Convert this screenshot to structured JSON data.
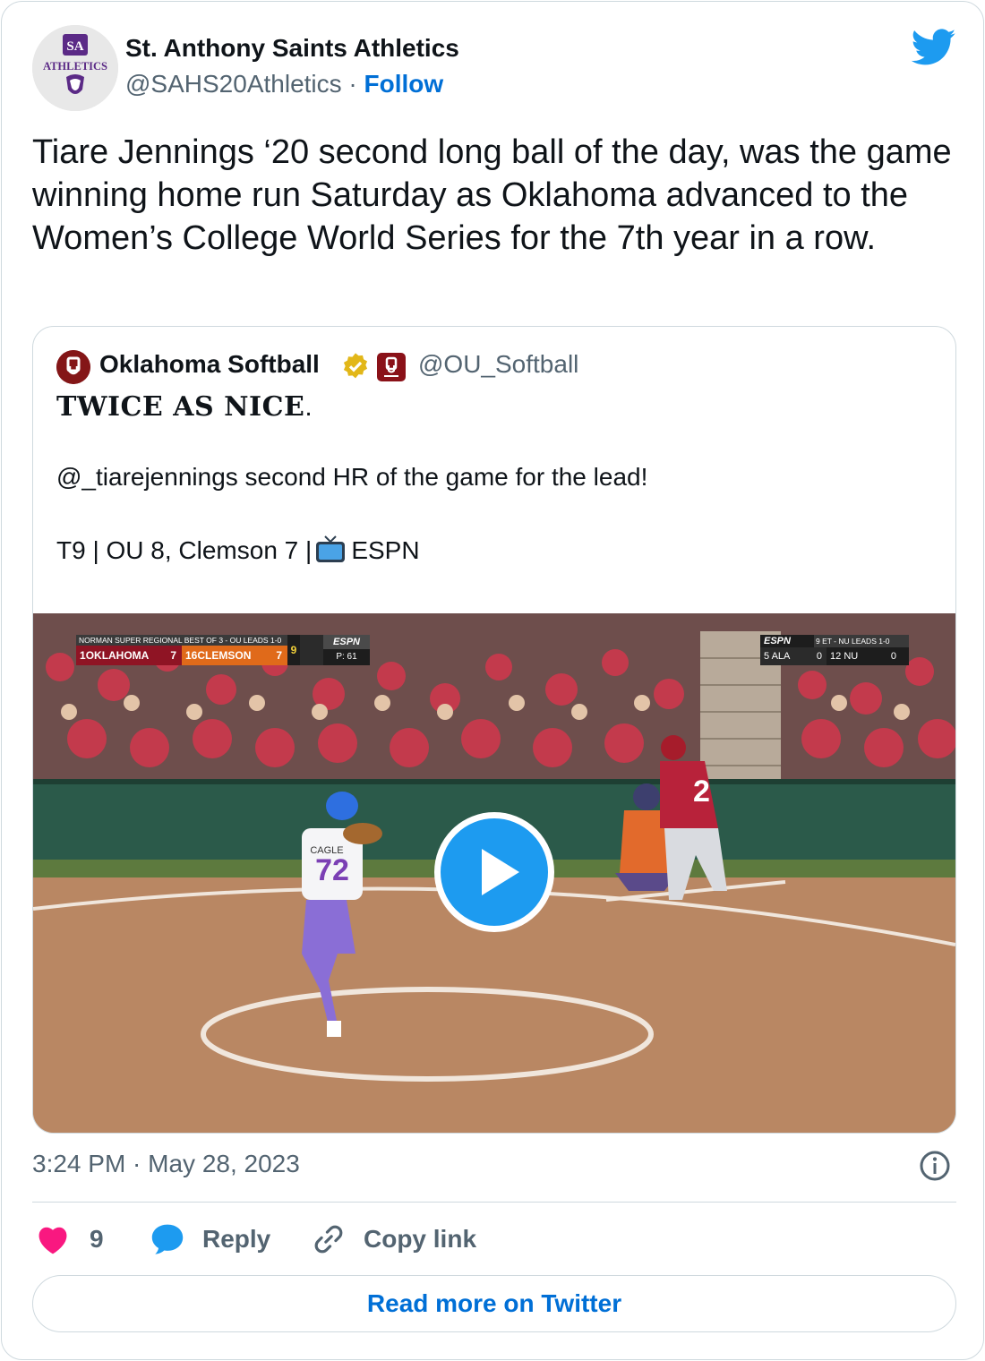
{
  "author": {
    "name": "St. Anthony Saints Athletics",
    "handle": "@SAHS20Athletics",
    "separator": "·",
    "follow_label": "Follow",
    "avatar_text": "ATHLETICS",
    "avatar_monogram": "SA"
  },
  "tweet": {
    "text": "Tiare Jennings ‘20 second long ball of the day, was the game winning home run Saturday as Oklahoma advanced to the Women’s College World Series for the 7th year in a row."
  },
  "quoted": {
    "name": "Oklahoma Softball",
    "handle": "@OU_Softball",
    "headline": "TWICE AS NICE",
    "headline_suffix": ".",
    "line2": "@_tiarejennings second HR of the game for the lead!",
    "line3_prefix": "T9 | OU 8, Clemson 7 |",
    "line3_suffix": "ESPN",
    "video": {
      "scoreboard_left": {
        "header": "NORMAN SUPER REGIONAL BEST OF 3 - OU LEADS 1-0",
        "team1_seed": "1",
        "team1": "OKLAHOMA",
        "team1_score": "7",
        "team2_seed": "16",
        "team2": "CLEMSON",
        "team2_score": "7",
        "inning": "9",
        "network": "ESPN",
        "pitch_count": "P: 61"
      },
      "scoreboard_right": {
        "network": "ESPN",
        "status": "9 ET - NU LEADS 1-0",
        "team1_seed": "5",
        "team1": "ALA",
        "team1_score": "0",
        "team2_seed": "12",
        "team2": "NU",
        "team2_score": "0"
      },
      "pitcher_name": "CAGLE",
      "pitcher_number": "72",
      "batter_number": "2"
    }
  },
  "meta": {
    "timestamp": "3:24 PM · May 28, 2023"
  },
  "actions": {
    "like_count": "9",
    "reply_label": "Reply",
    "copy_label": "Copy link"
  },
  "read_more_label": "Read more on Twitter",
  "colors": {
    "twitter_blue": "#1d9bf0",
    "link_blue": "#006fd6",
    "like_pink": "#f91880",
    "text_primary": "#0f1419",
    "text_secondary": "#536471",
    "border": "#cfd9de"
  }
}
